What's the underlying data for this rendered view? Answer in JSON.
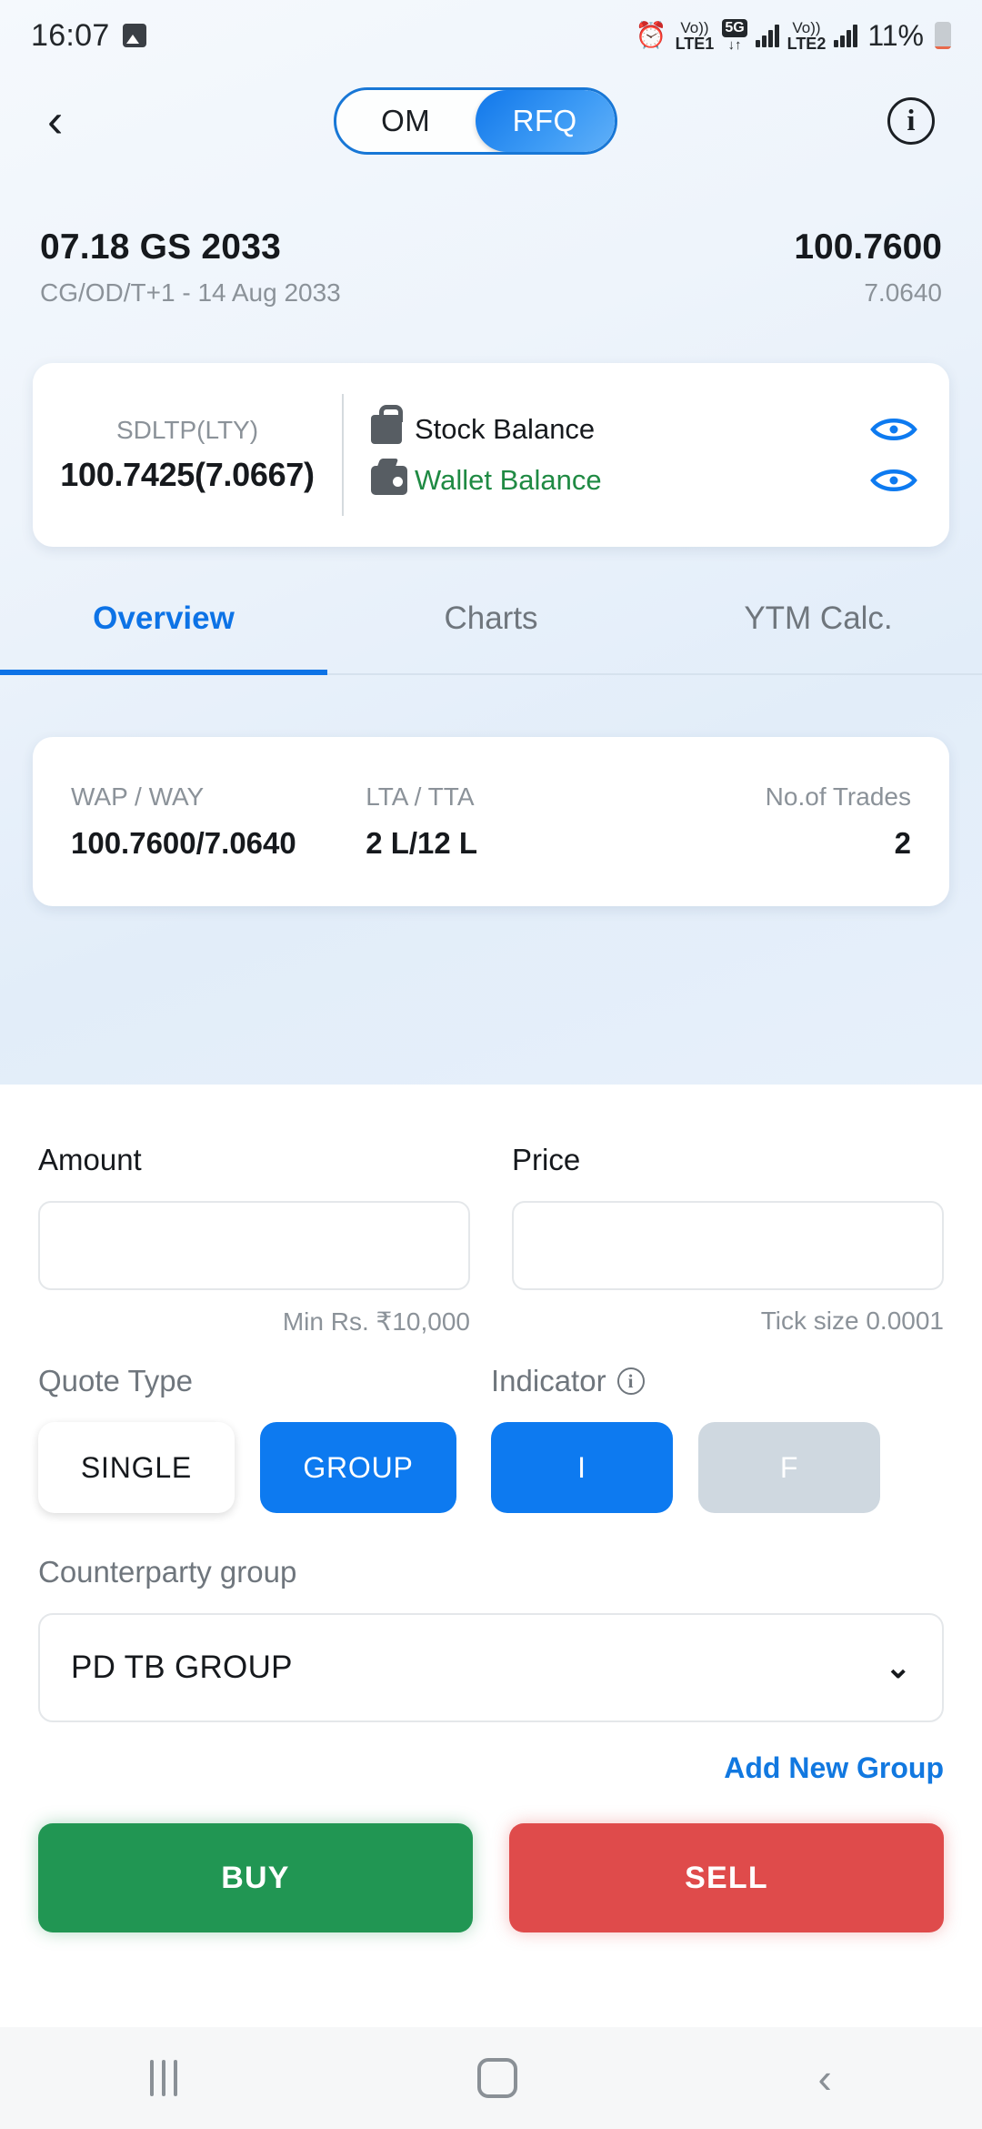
{
  "status_bar": {
    "time": "16:07",
    "image_icon": "picture-icon",
    "alarm_icon": "alarm-icon",
    "sim1_label_top": "Vo))",
    "sim1_label_bottom": "LTE1",
    "network_badge": "5G",
    "data_arrows": "↓↑",
    "sim2_label_top": "Vo))",
    "sim2_label_bottom": "LTE2",
    "battery_percent": "11%"
  },
  "app_bar": {
    "back_icon": "chevron-left-icon",
    "segments": [
      {
        "label": "OM",
        "active": false
      },
      {
        "label": "RFQ",
        "active": true
      }
    ],
    "info_icon_label": "i"
  },
  "instrument": {
    "name": "07.18 GS 2033",
    "subtitle": "CG/OD/T+1 - 14 Aug 2033",
    "price": "100.7600",
    "yield": "7.0640"
  },
  "ltp_card": {
    "label": "SDLTP(LTY)",
    "value": "100.7425(7.0667)",
    "balances": [
      {
        "label": "Stock Balance",
        "icon": "bag-icon",
        "color": "#16191d",
        "eye_icon": "eye-icon"
      },
      {
        "label": "Wallet Balance",
        "icon": "wallet-icon",
        "color": "#1f8a43",
        "eye_icon": "eye-icon"
      }
    ]
  },
  "tabs": [
    {
      "label": "Overview",
      "active": true
    },
    {
      "label": "Charts",
      "active": false
    },
    {
      "label": "YTM Calc.",
      "active": false
    }
  ],
  "stats": [
    {
      "label": "WAP / WAY",
      "value": "100.7600/7.0640"
    },
    {
      "label": "LTA / TTA",
      "value": "2 L/12 L"
    },
    {
      "label": "No.of Trades",
      "value": "2"
    }
  ],
  "order_form": {
    "amount": {
      "label": "Amount",
      "value": "",
      "placeholder": "",
      "hint": "Min Rs. ₹10,000"
    },
    "price": {
      "label": "Price",
      "value": "",
      "placeholder": "",
      "hint": "Tick size 0.0001"
    },
    "quote_type": {
      "label": "Quote Type",
      "options": [
        {
          "label": "SINGLE",
          "state": "inactive"
        },
        {
          "label": "GROUP",
          "state": "active"
        }
      ]
    },
    "indicator": {
      "label": "Indicator",
      "info_icon": "info-icon",
      "options": [
        {
          "label": "I",
          "state": "active"
        },
        {
          "label": "F",
          "state": "disabled"
        }
      ]
    },
    "counterparty": {
      "label": "Counterparty group",
      "selected": "PD TB GROUP",
      "caret_icon": "chevron-down-icon",
      "add_link": "Add New Group"
    },
    "actions": {
      "buy": "BUY",
      "sell": "SELL"
    }
  },
  "nav_bar": {
    "recents_icon": "recents-icon",
    "home_icon": "home-icon",
    "back_icon": "back-icon"
  },
  "colors": {
    "accent_blue": "#0d7af0",
    "buy_green": "#219653",
    "sell_red": "#df4b4b",
    "wallet_green": "#1f8a43"
  }
}
